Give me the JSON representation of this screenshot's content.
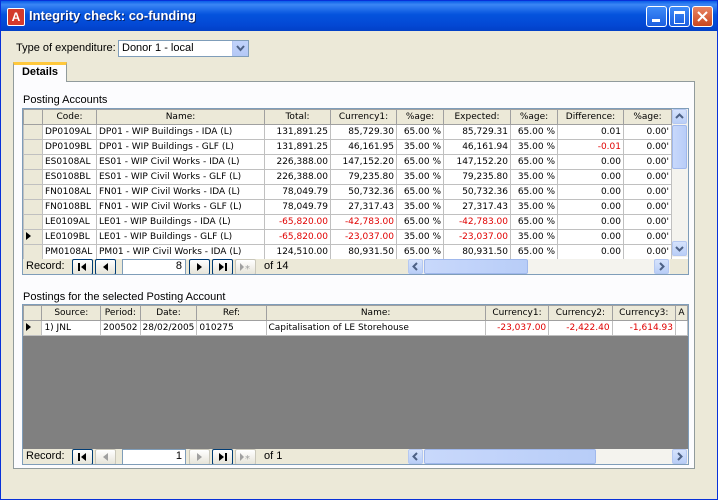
{
  "window": {
    "title": "Integrity check: co-funding",
    "app_icon": "A"
  },
  "filter": {
    "label": "Type of expenditure:",
    "value": "Donor 1 - local"
  },
  "tabs": [
    {
      "label": "Details"
    }
  ],
  "posting_accounts": {
    "title": "Posting Accounts",
    "headers": [
      "Code:",
      "Name:",
      "Total:",
      "Currency1:",
      "%age:",
      "Expected:",
      "%age:",
      "Difference:",
      "%age:"
    ],
    "rows": [
      {
        "code": "DP0109AL",
        "name": "DP01 - WIP Buildings - IDA (L)",
        "total": "131,891.25",
        "cur1": "85,729.30",
        "pct1": "65.00 %",
        "expected": "85,729.31",
        "pct2": "65.00 %",
        "diff": "0.01",
        "pct3": "0.00'",
        "neg": false,
        "diffneg": false
      },
      {
        "code": "DP0109BL",
        "name": "DP01 - WIP Buildings - GLF (L)",
        "total": "131,891.25",
        "cur1": "46,161.95",
        "pct1": "35.00 %",
        "expected": "46,161.94",
        "pct2": "35.00 %",
        "diff": "-0.01",
        "pct3": "0.00'",
        "neg": false,
        "diffneg": true
      },
      {
        "code": "ES0108AL",
        "name": "ES01 - WIP Civil Works - IDA (L)",
        "total": "226,388.00",
        "cur1": "147,152.20",
        "pct1": "65.00 %",
        "expected": "147,152.20",
        "pct2": "65.00 %",
        "diff": "0.00",
        "pct3": "0.00'",
        "neg": false,
        "diffneg": false
      },
      {
        "code": "ES0108BL",
        "name": "ES01 - WIP Civil Works - GLF (L)",
        "total": "226,388.00",
        "cur1": "79,235.80",
        "pct1": "35.00 %",
        "expected": "79,235.80",
        "pct2": "35.00 %",
        "diff": "0.00",
        "pct3": "0.00'",
        "neg": false,
        "diffneg": false
      },
      {
        "code": "FN0108AL",
        "name": "FN01 - WIP Civil Works - IDA (L)",
        "total": "78,049.79",
        "cur1": "50,732.36",
        "pct1": "65.00 %",
        "expected": "50,732.36",
        "pct2": "65.00 %",
        "diff": "0.00",
        "pct3": "0.00'",
        "neg": false,
        "diffneg": false
      },
      {
        "code": "FN0108BL",
        "name": "FN01 - WIP Civil Works - GLF (L)",
        "total": "78,049.79",
        "cur1": "27,317.43",
        "pct1": "35.00 %",
        "expected": "27,317.43",
        "pct2": "35.00 %",
        "diff": "0.00",
        "pct3": "0.00'",
        "neg": false,
        "diffneg": false
      },
      {
        "code": "LE0109AL",
        "name": "LE01 - WIP Buildings - IDA (L)",
        "total": "-65,820.00",
        "cur1": "-42,783.00",
        "pct1": "65.00 %",
        "expected": "-42,783.00",
        "pct2": "65.00 %",
        "diff": "0.00",
        "pct3": "0.00'",
        "neg": true,
        "diffneg": false
      },
      {
        "code": "LE0109BL",
        "name": "LE01 - WIP Buildings - GLF (L)",
        "total": "-65,820.00",
        "cur1": "-23,037.00",
        "pct1": "35.00 %",
        "expected": "-23,037.00",
        "pct2": "35.00 %",
        "diff": "0.00",
        "pct3": "0.00'",
        "neg": true,
        "diffneg": false,
        "selected": true
      },
      {
        "code": "PM0108AL",
        "name": "PM01 - WIP Civil Works - IDA (L)",
        "total": "124,510.00",
        "cur1": "80,931.50",
        "pct1": "65.00 %",
        "expected": "80,931.50",
        "pct2": "65.00 %",
        "diff": "0.00",
        "pct3": "0.00'",
        "neg": false,
        "diffneg": false
      }
    ],
    "nav": {
      "label": "Record:",
      "current": "8",
      "of": "of 14"
    }
  },
  "postings": {
    "title": "Postings for the selected Posting Account",
    "headers": [
      "Source:",
      "Period:",
      "Date:",
      "Ref:",
      "Name:",
      "Currency1:",
      "Currency2:",
      "Currency3:",
      "A"
    ],
    "rows": [
      {
        "source": "1) JNL",
        "period": "200502",
        "date": "28/02/2005",
        "ref": "010275",
        "name": "Capitalisation of LE Storehouse",
        "cur1": "-23,037.00",
        "cur2": "-2,422.40",
        "cur3": "-1,614.93"
      }
    ],
    "nav": {
      "label": "Record:",
      "current": "1",
      "of": "of 1"
    }
  },
  "colors": {
    "negative": "#E00000",
    "titlebar": "#0453DD",
    "tab_accent": "#FFC83C"
  }
}
